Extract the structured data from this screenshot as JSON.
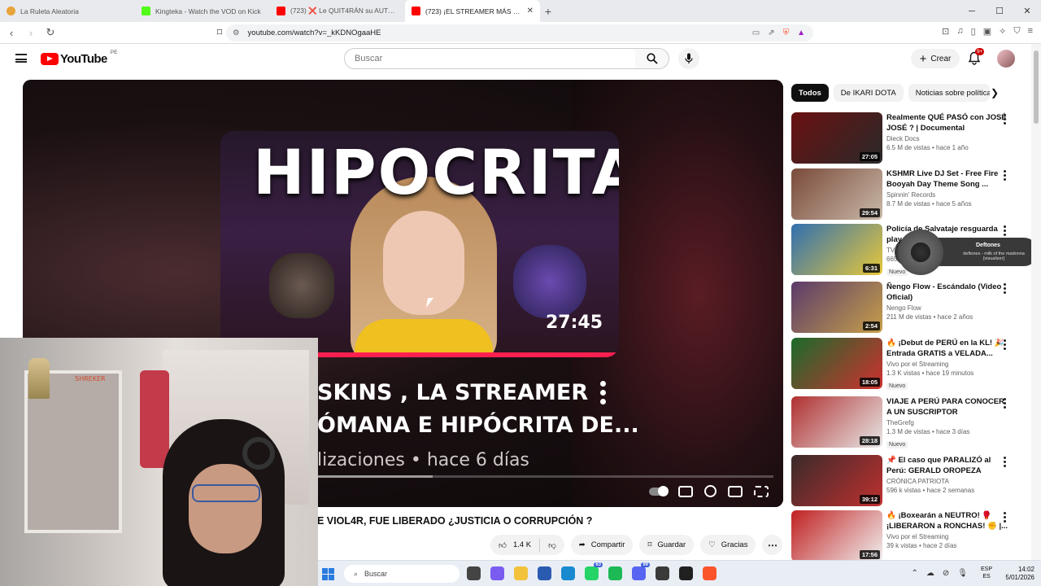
{
  "browser": {
    "tabs": [
      {
        "title": "La Ruleta Aleatoria",
        "icon": "roulette-icon",
        "color": "#e8a33a"
      },
      {
        "title": "Kingteka - Watch the VOD on Kick",
        "icon": "kick-icon",
        "color": "#53fc18"
      },
      {
        "title": "(723) ❌ Le QUIT4RÁN su AUTO...",
        "icon": "youtube-icon",
        "color": "#ff0000"
      },
      {
        "title": "(723) ¡EL STREAMER MÁS EN...",
        "icon": "youtube-icon",
        "color": "#ff0000"
      }
    ],
    "url": "youtube.com/watch?v=_kKDNOgaaHE"
  },
  "youtube": {
    "logo_text": "YouTube",
    "country": "PE",
    "search_placeholder": "Buscar",
    "create_label": "Crear",
    "notifications_badge": "9+"
  },
  "player": {
    "thumb_title": "HIPOCRITA",
    "thumb_duration": "27:45",
    "overlay_line1": "SKINS , LA STREAMER",
    "overlay_line2": "ÓMANA E HIPÓCRITA DE...",
    "overlay_meta": "lizaciones • hace 6 días",
    "progress_fraction": 0.038,
    "loaded_fraction": 0.54
  },
  "video": {
    "title": "E VIOL4R, FUE LIBERADO ¿JUSTICIA O CORRUPCIÓN ?",
    "likes": "1.4 K",
    "share": "Compartir",
    "save": "Guardar",
    "thanks": "Gracias"
  },
  "chips": [
    "Todos",
    "De IKARI DOTA",
    "Noticias sobre política"
  ],
  "recommendations": [
    {
      "title": "Realmente QUÉ PASÓ con JOSÉ JOSÉ ? | Documental",
      "channel": "Dieck Docs",
      "meta": "6.5 M de vistas • hace 1 año",
      "duration": "27:05",
      "badge": "",
      "colors": [
        "#6a1010",
        "#2a2a2a"
      ]
    },
    {
      "title": "KSHMR Live DJ Set - Free Fire Booyah Day Theme Song ...",
      "channel": "Spinnin' Records",
      "meta": "8.7 M de vistas • hace 5 años",
      "duration": "29:54",
      "badge": "",
      "colors": [
        "#7a4a3a",
        "#c9b9a8"
      ]
    },
    {
      "title": "Policía de Salvataje resguarda play...",
      "channel": "TV...",
      "meta": "665...",
      "duration": "6:31",
      "badge": "Nuevo",
      "colors": [
        "#2f6fb0",
        "#e8c83a"
      ]
    },
    {
      "title": "Ñengo Flow - Escándalo (Video Oficial)",
      "channel": "Nengo Flow",
      "meta": "211 M de vistas • hace 2 años",
      "duration": "2:54",
      "badge": "",
      "colors": [
        "#5a3a6a",
        "#c7a04a"
      ]
    },
    {
      "title": "🔥 ¡Debut de PERÚ en la KL! 🎉 Entrada GRATIS a VELADA...",
      "channel": "Vivo por el Streaming",
      "meta": "1.3 K vistas • hace 19 minutos",
      "duration": "18:05",
      "badge": "Nuevo",
      "colors": [
        "#1a6a2a",
        "#d03030"
      ]
    },
    {
      "title": "VIAJE A PERÚ PARA CONOCER A UN SUSCRIPTOR",
      "channel": "TheGrefg",
      "meta": "1.3 M de vistas • hace 3 días",
      "duration": "28:18",
      "badge": "Nuevo",
      "colors": [
        "#b03030",
        "#e8e8e8"
      ]
    },
    {
      "title": "📌 El caso que PARALIZÓ al Perú: GERALD OROPEZA",
      "channel": "CRÓNICA PATRIOTA",
      "meta": "596 k vistas • hace 2 semanas",
      "duration": "39:12",
      "badge": "",
      "colors": [
        "#3a2a2a",
        "#c03030"
      ]
    },
    {
      "title": "🔥 ¡Boxearán a NEUTRO! 🥊 ¡LIBERARON a RONCHAS! ✊ |...",
      "channel": "Vivo por el Streaming",
      "meta": "39 k vistas • hace 2 días",
      "duration": "17:56",
      "badge": "",
      "colors": [
        "#c02020",
        "#f0f0f0"
      ]
    }
  ],
  "now_playing": {
    "title": "Deftones",
    "subtitle": "deftones - milk of the madonna [visualizer]"
  },
  "webcam": {
    "sign_text": "SHREKER"
  },
  "taskbar": {
    "search_placeholder": "Buscar",
    "apps": [
      {
        "icon": "taskview-icon",
        "color": "#444444",
        "badge": ""
      },
      {
        "icon": "copilot-icon",
        "color": "#7a5cf0",
        "badge": ""
      },
      {
        "icon": "file-explorer-icon",
        "color": "#f2c23a",
        "badge": ""
      },
      {
        "icon": "store-icon",
        "color": "#2a5bb0",
        "badge": ""
      },
      {
        "icon": "edge-icon",
        "color": "#1a8ad0",
        "badge": ""
      },
      {
        "icon": "whatsapp-icon",
        "color": "#25d366",
        "badge": "63"
      },
      {
        "icon": "spotify-icon",
        "color": "#1db954",
        "badge": ""
      },
      {
        "icon": "discord-icon",
        "color": "#5865f2",
        "badge": "99"
      },
      {
        "icon": "app-icon",
        "color": "#3a3a3a",
        "badge": ""
      },
      {
        "icon": "obs-icon",
        "color": "#202020",
        "badge": ""
      },
      {
        "icon": "brave-icon",
        "color": "#fb542b",
        "badge": ""
      }
    ],
    "lang_top": "ESP",
    "lang_bottom": "ES",
    "time": "14:02",
    "date": "5/01/2026"
  }
}
